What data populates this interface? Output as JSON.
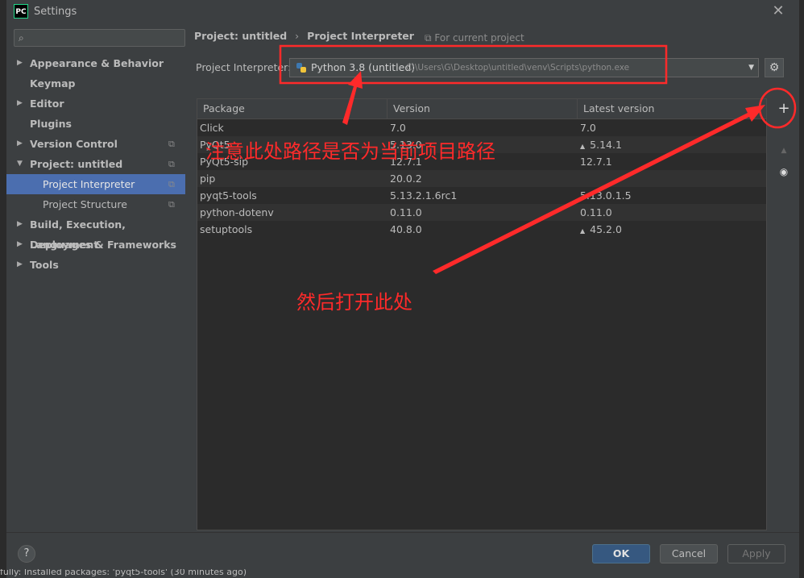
{
  "window": {
    "title": "Settings",
    "app_icon": "PC"
  },
  "sidebar": {
    "search_placeholder": "",
    "items": [
      {
        "label": "Appearance & Behavior",
        "arrow": "▶",
        "copy": ""
      },
      {
        "label": "Keymap",
        "arrow": "",
        "copy": ""
      },
      {
        "label": "Editor",
        "arrow": "▶",
        "copy": ""
      },
      {
        "label": "Plugins",
        "arrow": "",
        "copy": ""
      },
      {
        "label": "Version Control",
        "arrow": "▶",
        "copy": "⧉"
      },
      {
        "label": "Project: untitled",
        "arrow": "▼",
        "copy": "⧉"
      },
      {
        "label": "Project Interpreter",
        "arrow": "",
        "copy": "⧉"
      },
      {
        "label": "Project Structure",
        "arrow": "",
        "copy": "⧉"
      },
      {
        "label": "Build, Execution, Deployment",
        "arrow": "▶",
        "copy": ""
      },
      {
        "label": "Languages & Frameworks",
        "arrow": "▶",
        "copy": ""
      },
      {
        "label": "Tools",
        "arrow": "▶",
        "copy": ""
      }
    ]
  },
  "breadcrumb": {
    "project": "Project: untitled",
    "separator": "›",
    "page": "Project Interpreter"
  },
  "for_current_project": "⧉ For current project",
  "interpreter": {
    "label": "Project Interpreter:",
    "name": "Python 3.8 (untitled)",
    "path": "C:\\Users\\G\\Desktop\\untitled\\venv\\Scripts\\python.exe"
  },
  "table": {
    "headers": [
      "Package",
      "Version",
      "Latest version"
    ],
    "rows": [
      {
        "package": "Click",
        "version": "7.0",
        "latest": "7.0",
        "upgrade": false
      },
      {
        "package": "PyQt5",
        "version": "5.13.0",
        "latest": "5.14.1",
        "upgrade": true
      },
      {
        "package": "PyQt5-sip",
        "version": "12.7.1",
        "latest": "12.7.1",
        "upgrade": false
      },
      {
        "package": "pip",
        "version": "20.0.2",
        "latest": "",
        "upgrade": false
      },
      {
        "package": "pyqt5-tools",
        "version": "5.13.2.1.6rc1",
        "latest": "5.13.0.1.5",
        "upgrade": false
      },
      {
        "package": "python-dotenv",
        "version": "0.11.0",
        "latest": "0.11.0",
        "upgrade": false
      },
      {
        "package": "setuptools",
        "version": "40.8.0",
        "latest": "45.2.0",
        "upgrade": true
      }
    ]
  },
  "tools": {
    "add": "+",
    "up": "▲",
    "eye": "◉"
  },
  "footer": {
    "help": "?",
    "ok": "OK",
    "cancel": "Cancel",
    "apply": "Apply"
  },
  "status_bar": "fully: Installed packages: 'pyqt5-tools' (30 minutes ago)",
  "annotations": {
    "note1": "注意此处路径是否为当前项目路径",
    "note2": "然后打开此处",
    "color": "#ff2a2a"
  },
  "colors": {
    "selection": "#4b6eaf",
    "ok_button": "#365880",
    "background": "#3c3f41"
  }
}
